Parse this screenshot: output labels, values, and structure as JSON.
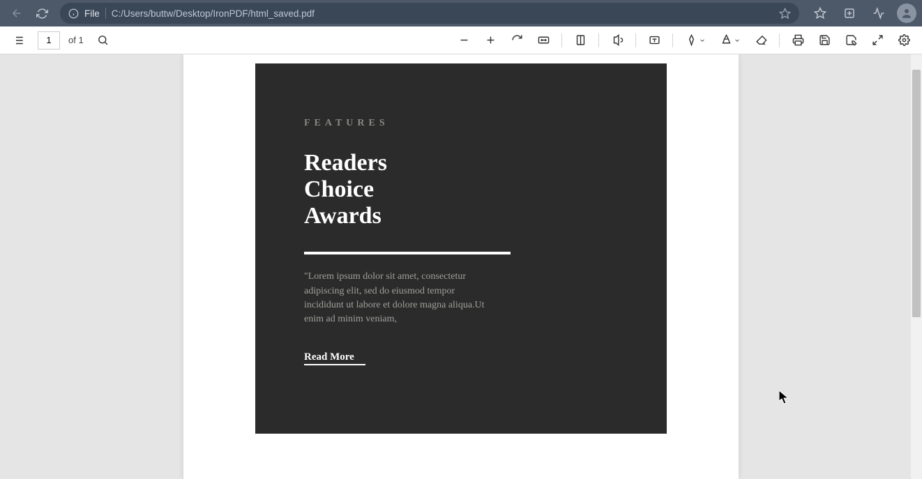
{
  "browser": {
    "address_prefix_label": "File",
    "address_path": "C:/Users/buttw/Desktop/IronPDF/html_saved.pdf"
  },
  "pdf_toolbar": {
    "current_page": "1",
    "page_total_label": "of 1"
  },
  "document": {
    "eyebrow": "FEATURES",
    "headline_l1": "Readers",
    "headline_l2": "Choice",
    "headline_l3": "Awards",
    "body": "\"Lorem ipsum dolor sit amet, consectetur adipiscing elit, sed do eiusmod tempor incididunt ut labore et dolore magna aliqua.Ut enim ad minim veniam,",
    "read_more": "Read More"
  }
}
